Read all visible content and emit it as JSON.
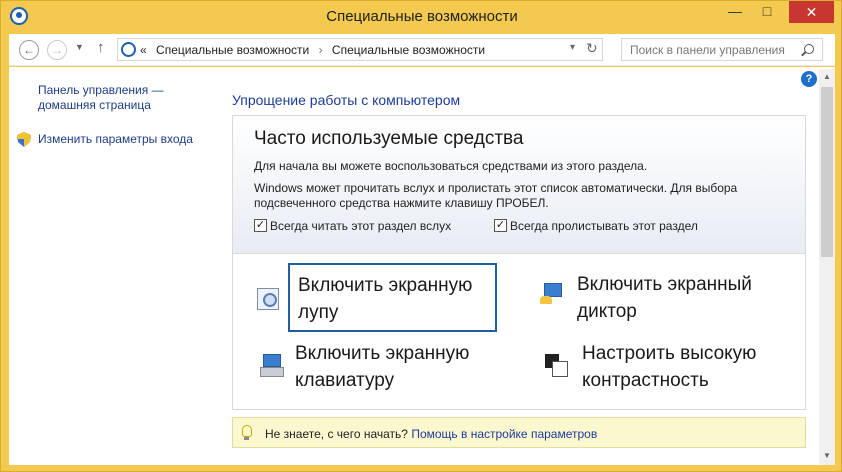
{
  "window": {
    "title": "Специальные возможности",
    "minimize": "—",
    "maximize": "□",
    "close": "✕"
  },
  "nav": {
    "back": "←",
    "forward": "→",
    "recent": "▼",
    "up": "↑",
    "address": {
      "lead": "«",
      "crumbs": [
        "Специальные возможности",
        "Специальные возможности"
      ],
      "separator": "›"
    },
    "dropdown": "▾",
    "refresh": "↻",
    "search_placeholder": "Поиск в панели управления"
  },
  "sidebar": {
    "home_link": "Панель управления — домашняя страница",
    "signin_link": "Изменить параметры входа"
  },
  "main": {
    "help": "?",
    "heading": "Упрощение работы с компьютером",
    "panel": {
      "title": "Часто используемые средства",
      "text1": "Для начала вы можете воспользоваться средствами из этого раздела.",
      "text2": "Windows может прочитать вслух и пролистать этот список автоматически. Для выбора подсвеченного средства нажмите клавишу ПРОБЕЛ.",
      "check1": {
        "label": "Всегда читать этот раздел вслух",
        "checked": true,
        "mark": "✓"
      },
      "check2": {
        "label": "Всегда пролистывать этот раздел",
        "checked": true,
        "mark": "✓"
      }
    },
    "tools": [
      {
        "label": "Включить экранную лупу",
        "icon": "magnifier-icon"
      },
      {
        "label": "Включить экранный диктор",
        "icon": "narrator-icon"
      },
      {
        "label": "Включить экранную клавиатуру",
        "icon": "keyboard-icon"
      },
      {
        "label": "Настроить высокую контрастность",
        "icon": "contrast-icon"
      }
    ],
    "hint": {
      "text": "Не знаете, с чего начать?",
      "link": "Помощь в настройке параметров"
    }
  },
  "scrollbar": {
    "up": "▲",
    "down": "▼"
  },
  "colors": {
    "frame": "#f3c94f",
    "close": "#c7372f",
    "link": "#1e3c82",
    "heading": "#1e3c9a"
  }
}
